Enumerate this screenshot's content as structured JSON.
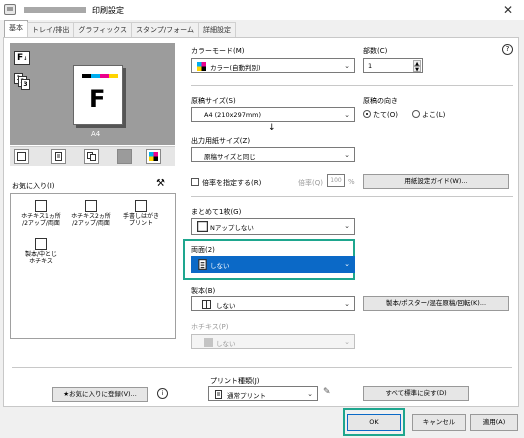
{
  "window": {
    "title": "印刷設定"
  },
  "tabs": [
    "基本",
    "トレイ/排出",
    "グラフィックス",
    "スタンプ/フォーム",
    "詳細設定"
  ],
  "preview": {
    "paper_label": "A4",
    "sheet_letter": "F"
  },
  "left": {
    "favorites_label": "お気に入り(I)",
    "favorites": [
      "ホチキス1ヵ所\n/2アップ/両面",
      "ホチキス2ヵ所\n/2アップ/両面",
      "手書しはがき\nプリント",
      "製本/中とじ\nホチキス"
    ],
    "add_favorite": "お気に入りに登録(V)..."
  },
  "color_mode": {
    "label": "カラーモード(M)",
    "value": "カラー(自動判別)"
  },
  "copies": {
    "label": "部数(C)",
    "value": "1"
  },
  "help_icon": "?",
  "original_size": {
    "label": "原稿サイズ(S)",
    "value": "A4 (210x297mm)"
  },
  "orientation": {
    "label": "原稿の向き",
    "options": [
      "たて(O)",
      "よこ(L)"
    ],
    "selected": "たて(O)"
  },
  "output_size": {
    "label": "出力用紙サイズ(Z)",
    "value": "原稿サイズと同じ"
  },
  "zoom": {
    "check_label": "倍率を指定する(R)",
    "ratio_label": "倍率(Q)",
    "ratio_value": "100",
    "ratio_unit": "%"
  },
  "paper_guide_button": "用紙設定ガイド(W)...",
  "nup": {
    "label": "まとめて1枚(G)",
    "value": "Nアップしない"
  },
  "duplex": {
    "label": "両面(2)",
    "value": "しない"
  },
  "booklet": {
    "label": "製本(B)",
    "value": "しない",
    "button": "製本/ポスター/混在原稿/回転(K)..."
  },
  "staple": {
    "label": "ホチキス(P)",
    "value": "しない"
  },
  "print_type": {
    "label": "プリント種類(J)",
    "value": "通常プリント"
  },
  "reset_button": "すべて標準に戻す(D)",
  "footer": {
    "ok": "OK",
    "cancel": "キャンセル",
    "apply": "適用(A)"
  },
  "colors": {
    "accent": "#1ea68e",
    "selection": "#0b69c7"
  }
}
